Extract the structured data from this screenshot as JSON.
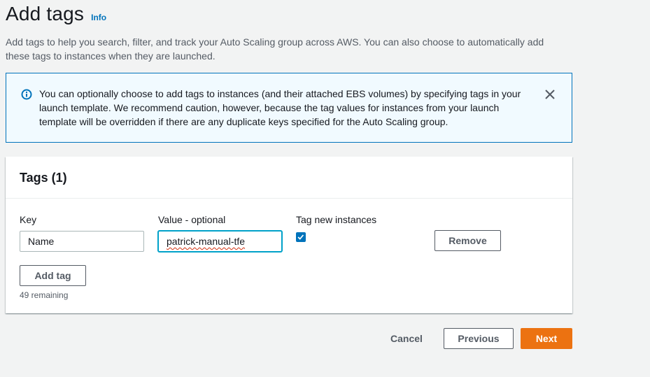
{
  "header": {
    "title": "Add tags",
    "info_label": "Info",
    "description": "Add tags to help you search, filter, and track your Auto Scaling group across AWS. You can also choose to automatically add these tags to instances when they are launched."
  },
  "alert": {
    "text": "You can optionally choose to add tags to instances (and their attached EBS volumes) by specifying tags in your launch template. We recommend caution, however, because the tag values for instances from your launch template will be overridden if there are any duplicate keys specified for the Auto Scaling group.",
    "icon": "info-circle-icon",
    "close_icon": "close-icon"
  },
  "tags_card": {
    "title": "Tags (1)",
    "key_label": "Key",
    "value_label": "Value - optional",
    "tag_instances_label": "Tag new instances",
    "rows": [
      {
        "key": "Name",
        "value": "patrick-manual-tfe",
        "tag_new_instances": true
      }
    ],
    "remove_label": "Remove",
    "add_tag_label": "Add tag",
    "remaining": "49 remaining"
  },
  "footer": {
    "cancel_label": "Cancel",
    "previous_label": "Previous",
    "next_label": "Next"
  },
  "colors": {
    "accent": "#0073bb",
    "primary_button": "#ec7211",
    "alert_background": "#f1faff",
    "page_background": "#f2f3f3",
    "focus": "#00a1c9"
  }
}
